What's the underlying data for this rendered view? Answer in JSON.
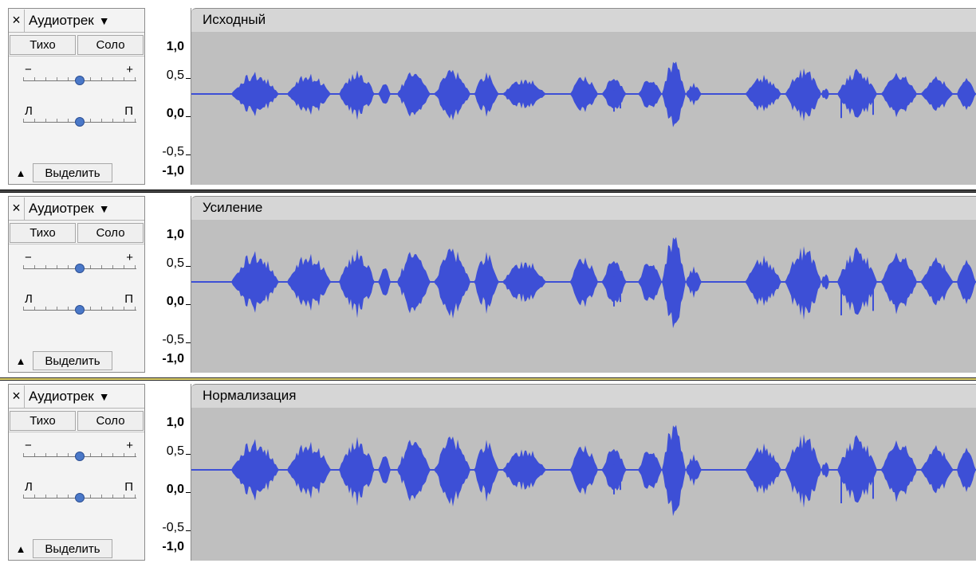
{
  "tracks": [
    {
      "title": "Исходный",
      "menu_label": "Аудиотрек",
      "close_label": "×",
      "mute_label": "Тихо",
      "solo_label": "Соло",
      "gain_min_label": "−",
      "gain_max_label": "+",
      "pan_left_label": "Л",
      "pan_right_label": "П",
      "select_label": "Выделить",
      "gain_level": 0.5,
      "pan_level": 0.5,
      "scale": [
        "1,0",
        "0,5-",
        "0,0-",
        "-0,5-",
        "-1,0"
      ],
      "amplitude_factor": 0.72
    },
    {
      "title": "Усиление",
      "menu_label": "Аудиотрек",
      "close_label": "×",
      "mute_label": "Тихо",
      "solo_label": "Соло",
      "gain_min_label": "−",
      "gain_max_label": "+",
      "pan_left_label": "Л",
      "pan_right_label": "П",
      "select_label": "Выделить",
      "gain_level": 0.5,
      "pan_level": 0.5,
      "scale": [
        "1,0",
        "0,5-",
        "0,0-",
        "-0,5-",
        "-1,0"
      ],
      "amplitude_factor": 1.0
    },
    {
      "title": "Нормализация",
      "menu_label": "Аудиотрек",
      "close_label": "×",
      "mute_label": "Тихо",
      "solo_label": "Соло",
      "gain_min_label": "−",
      "gain_max_label": "+",
      "pan_left_label": "Л",
      "pan_right_label": "П",
      "select_label": "Выделить",
      "gain_level": 0.5,
      "pan_level": 0.5,
      "scale": [
        "1,0",
        "0,5-",
        "0,0-",
        "-0,5-",
        "-1,0"
      ],
      "amplitude_factor": 1.0
    }
  ],
  "colors": {
    "waveform": "#3d4fd6",
    "waveform_rms": "#5a6ce8",
    "background": "#bfbfbf",
    "zero_line": "#3d4fd6"
  },
  "icons": {
    "close": "close-icon",
    "menu_arrow": "dropdown-arrow-icon",
    "collapse": "collapse-triangle-icon"
  }
}
